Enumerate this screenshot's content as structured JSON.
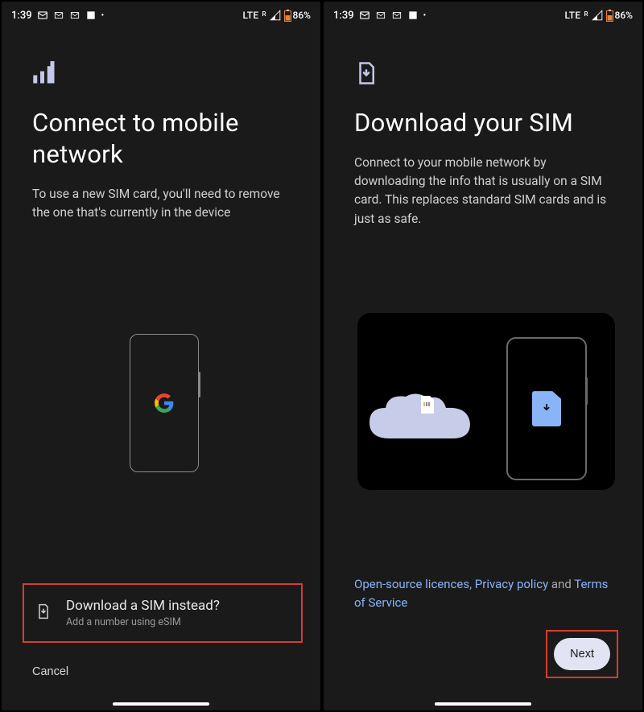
{
  "status_bar": {
    "time": "1:39",
    "network_label": "LTE",
    "roaming": "R",
    "battery": "86%"
  },
  "screen_left": {
    "title": "Connect to mobile network",
    "body": "To use a new SIM card, you'll need to remove the one that's currently in the device",
    "download_option": {
      "title": "Download a SIM instead?",
      "subtitle": "Add a number using eSIM"
    },
    "cancel": "Cancel"
  },
  "screen_right": {
    "title": "Download your SIM",
    "body": "Connect to your mobile network by downloading the info that is usually on a SIM card. This replaces standard SIM cards and is just as safe.",
    "links": {
      "open_source": "Open-source licences",
      "privacy": "Privacy policy",
      "and": " and ",
      "tos": "Terms of Service",
      "sep": ", "
    },
    "next": "Next"
  }
}
